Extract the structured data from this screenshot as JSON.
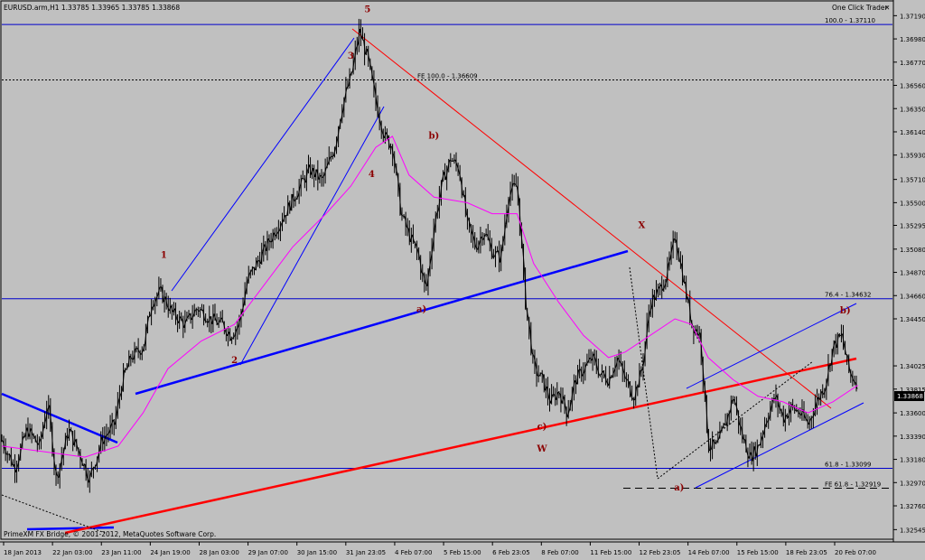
{
  "header": {
    "title": "EURUSD.arm,H1 1.33785 1.33965 1.33785 1.33868",
    "one_click": "One Click Trader",
    "close_glyph": "✕"
  },
  "footer": {
    "copyright": "PrimeXM FX Bridge, © 2001-2012, MetaQuotes Software Corp."
  },
  "colors": {
    "background": "#c0c0c0",
    "candle": "#000000",
    "ma": "#ff00ff",
    "trend_blue": "#0000ff",
    "trend_red": "#ff0000",
    "wave_label": "#8b0000",
    "price_tag_bg": "#000000"
  },
  "chart_data": {
    "type": "candlestick",
    "symbol": "EURUSD.arm",
    "timeframe": "H1",
    "last_price": "1.33868",
    "ylim": [
      1.3245,
      1.3725
    ],
    "y_ticks": [
      "1.37190",
      "1.36980",
      "1.36770",
      "1.36560",
      "1.36350",
      "1.36140",
      "1.35930",
      "1.35710",
      "1.35500",
      "1.35295",
      "1.35080",
      "1.34870",
      "1.34660",
      "1.34450",
      "1.34025",
      "1.33815",
      "1.33600",
      "1.33390",
      "1.33180",
      "1.32970",
      "1.32760",
      "1.32545"
    ],
    "x_ticks": [
      "18 Jan 2013",
      "22 Jan 03:00",
      "23 Jan 11:00",
      "24 Jan 19:00",
      "28 Jan 03:00",
      "29 Jan 07:00",
      "30 Jan 15:00",
      "31 Jan 23:05",
      "4 Feb 07:00",
      "5 Feb 15:00",
      "6 Feb 23:05",
      "8 Feb 07:00",
      "11 Feb 15:00",
      "12 Feb 23:05",
      "14 Feb 07:00",
      "15 Feb 15:00",
      "18 Feb 23:05",
      "20 Feb 07:00"
    ],
    "price_path": [
      [
        0,
        1.3335
      ],
      [
        3,
        1.331
      ],
      [
        6,
        1.3345
      ],
      [
        9,
        1.333
      ],
      [
        11,
        1.337
      ],
      [
        13,
        1.33
      ],
      [
        16,
        1.3345
      ],
      [
        19,
        1.332
      ],
      [
        21,
        1.33
      ],
      [
        24,
        1.3335
      ],
      [
        27,
        1.335
      ],
      [
        29,
        1.339
      ],
      [
        31,
        1.341
      ],
      [
        34,
        1.342
      ],
      [
        36,
        1.346
      ],
      [
        38,
        1.347
      ],
      [
        41,
        1.345
      ],
      [
        44,
        1.344
      ],
      [
        47,
        1.3455
      ],
      [
        50,
        1.3445
      ],
      [
        53,
        1.344
      ],
      [
        55,
        1.343
      ],
      [
        57,
        1.344
      ],
      [
        59,
        1.348
      ],
      [
        62,
        1.35
      ],
      [
        65,
        1.352
      ],
      [
        68,
        1.354
      ],
      [
        71,
        1.356
      ],
      [
        74,
        1.358
      ],
      [
        77,
        1.357
      ],
      [
        80,
        1.36
      ],
      [
        82,
        1.364
      ],
      [
        84,
        1.3665
      ],
      [
        86,
        1.3705
      ],
      [
        88,
        1.368
      ],
      [
        90,
        1.364
      ],
      [
        92,
        1.361
      ],
      [
        94,
        1.36
      ],
      [
        96,
        1.354
      ],
      [
        98,
        1.352
      ],
      [
        100,
        1.3505
      ],
      [
        102,
        1.347
      ],
      [
        104,
        1.353
      ],
      [
        106,
        1.357
      ],
      [
        108,
        1.359
      ],
      [
        110,
        1.358
      ],
      [
        112,
        1.353
      ],
      [
        114,
        1.351
      ],
      [
        116,
        1.3525
      ],
      [
        118,
        1.3505
      ],
      [
        120,
        1.35
      ],
      [
        122,
        1.356
      ],
      [
        124,
        1.3565
      ],
      [
        126,
        1.346
      ],
      [
        128,
        1.34
      ],
      [
        130,
        1.339
      ],
      [
        132,
        1.337
      ],
      [
        134,
        1.338
      ],
      [
        136,
        1.336
      ],
      [
        138,
        1.339
      ],
      [
        140,
        1.34
      ],
      [
        142,
        1.341
      ],
      [
        144,
        1.3395
      ],
      [
        146,
        1.339
      ],
      [
        148,
        1.341
      ],
      [
        150,
        1.339
      ],
      [
        152,
        1.3375
      ],
      [
        154,
        1.34
      ],
      [
        156,
        1.346
      ],
      [
        158,
        1.347
      ],
      [
        160,
        1.3485
      ],
      [
        162,
        1.352
      ],
      [
        164,
        1.348
      ],
      [
        166,
        1.344
      ],
      [
        168,
        1.343
      ],
      [
        170,
        1.333
      ],
      [
        172,
        1.333
      ],
      [
        174,
        1.335
      ],
      [
        176,
        1.3375
      ],
      [
        178,
        1.334
      ],
      [
        180,
        1.332
      ],
      [
        182,
        1.333
      ],
      [
        184,
        1.3355
      ],
      [
        186,
        1.3375
      ],
      [
        188,
        1.3355
      ],
      [
        190,
        1.3365
      ],
      [
        192,
        1.336
      ],
      [
        194,
        1.335
      ],
      [
        196,
        1.337
      ],
      [
        198,
        1.3385
      ],
      [
        200,
        1.342
      ],
      [
        202,
        1.343
      ],
      [
        204,
        1.3395
      ],
      [
        206,
        1.3386
      ]
    ],
    "ma_path": [
      [
        0,
        1.333
      ],
      [
        10,
        1.3325
      ],
      [
        20,
        1.332
      ],
      [
        28,
        1.333
      ],
      [
        34,
        1.336
      ],
      [
        40,
        1.34
      ],
      [
        48,
        1.3425
      ],
      [
        56,
        1.344
      ],
      [
        62,
        1.347
      ],
      [
        70,
        1.351
      ],
      [
        78,
        1.354
      ],
      [
        84,
        1.3565
      ],
      [
        90,
        1.36
      ],
      [
        94,
        1.361
      ],
      [
        98,
        1.3575
      ],
      [
        104,
        1.3555
      ],
      [
        112,
        1.355
      ],
      [
        118,
        1.354
      ],
      [
        124,
        1.354
      ],
      [
        128,
        1.3495
      ],
      [
        134,
        1.346
      ],
      [
        140,
        1.343
      ],
      [
        146,
        1.341
      ],
      [
        150,
        1.3415
      ],
      [
        156,
        1.343
      ],
      [
        162,
        1.3445
      ],
      [
        166,
        1.344
      ],
      [
        170,
        1.341
      ],
      [
        176,
        1.339
      ],
      [
        182,
        1.3375
      ],
      [
        188,
        1.337
      ],
      [
        194,
        1.336
      ],
      [
        200,
        1.337
      ],
      [
        206,
        1.3385
      ]
    ],
    "x_max": 210
  },
  "annotations": {
    "waves": [
      {
        "label": "5",
        "x": 88,
        "price": 1.3722
      },
      {
        "label": "3",
        "x": 84,
        "price": 1.368
      },
      {
        "label": "1",
        "x": 39,
        "price": 1.35
      },
      {
        "label": "4",
        "x": 89,
        "price": 1.3573
      },
      {
        "label": "2",
        "x": 56,
        "price": 1.3405
      },
      {
        "label": "b)",
        "x": 104,
        "price": 1.3608
      },
      {
        "label": "a)",
        "x": 101,
        "price": 1.3451
      },
      {
        "label": "X",
        "x": 154,
        "price": 1.3527
      },
      {
        "label": "c)",
        "x": 130,
        "price": 1.3345
      },
      {
        "label": "W",
        "x": 130,
        "price": 1.3325
      },
      {
        "label": "a)",
        "x": 163,
        "price": 1.329
      },
      {
        "label": "b)",
        "x": 203,
        "price": 1.345
      }
    ],
    "levels": [
      {
        "label": "100.0 - 1.37110",
        "price": 1.3711,
        "style": "solid"
      },
      {
        "label": "FE 100.0 - 1.36609",
        "price": 1.36609,
        "style": "dotted"
      },
      {
        "label": "76.4 - 1.34632",
        "price": 1.34632,
        "style": "solid"
      },
      {
        "label": "61.8 - 1.33099",
        "price": 1.33099,
        "style": "solid"
      },
      {
        "label": "FE 61.8 - 1.32919",
        "price": 1.32919,
        "style": "dashed"
      }
    ]
  }
}
